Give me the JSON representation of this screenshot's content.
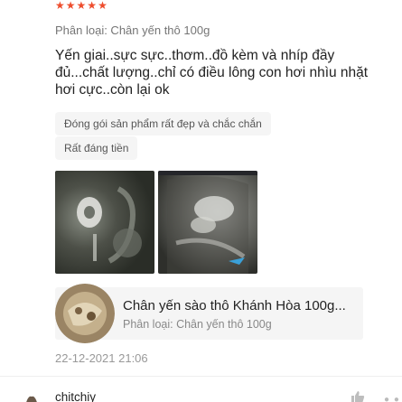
{
  "review": {
    "rating": 5,
    "star_glyph": "★",
    "variant": "Phân loại: Chân yến thô 100g",
    "text": "Yến giai..sực sực..thơm..đồ kèm và nhíp đầy đủ...chất lượng..chỉ có điều lông con hơi nhìu nhặt hơi cực..còn lại ok",
    "tags": [
      "Đóng gói sản phẩm rất đẹp và chắc chắn",
      "Rất đáng tiền"
    ],
    "photos": [
      "photo-1",
      "photo-2"
    ],
    "product": {
      "name": "Chân yến sào thô Khánh Hòa 100g...",
      "variant": "Phân loại: Chân yến thô 100g"
    },
    "date": "22-12-2021 21:06"
  },
  "next_review": {
    "username": "chitchiy"
  },
  "icons": {
    "like": "thumbs-up-icon",
    "more": "more-options-icon",
    "star": "star-icon"
  },
  "colors": {
    "star": "#ee4d2d",
    "tag_bg": "#f5f5f5",
    "muted_text": "#757575"
  }
}
